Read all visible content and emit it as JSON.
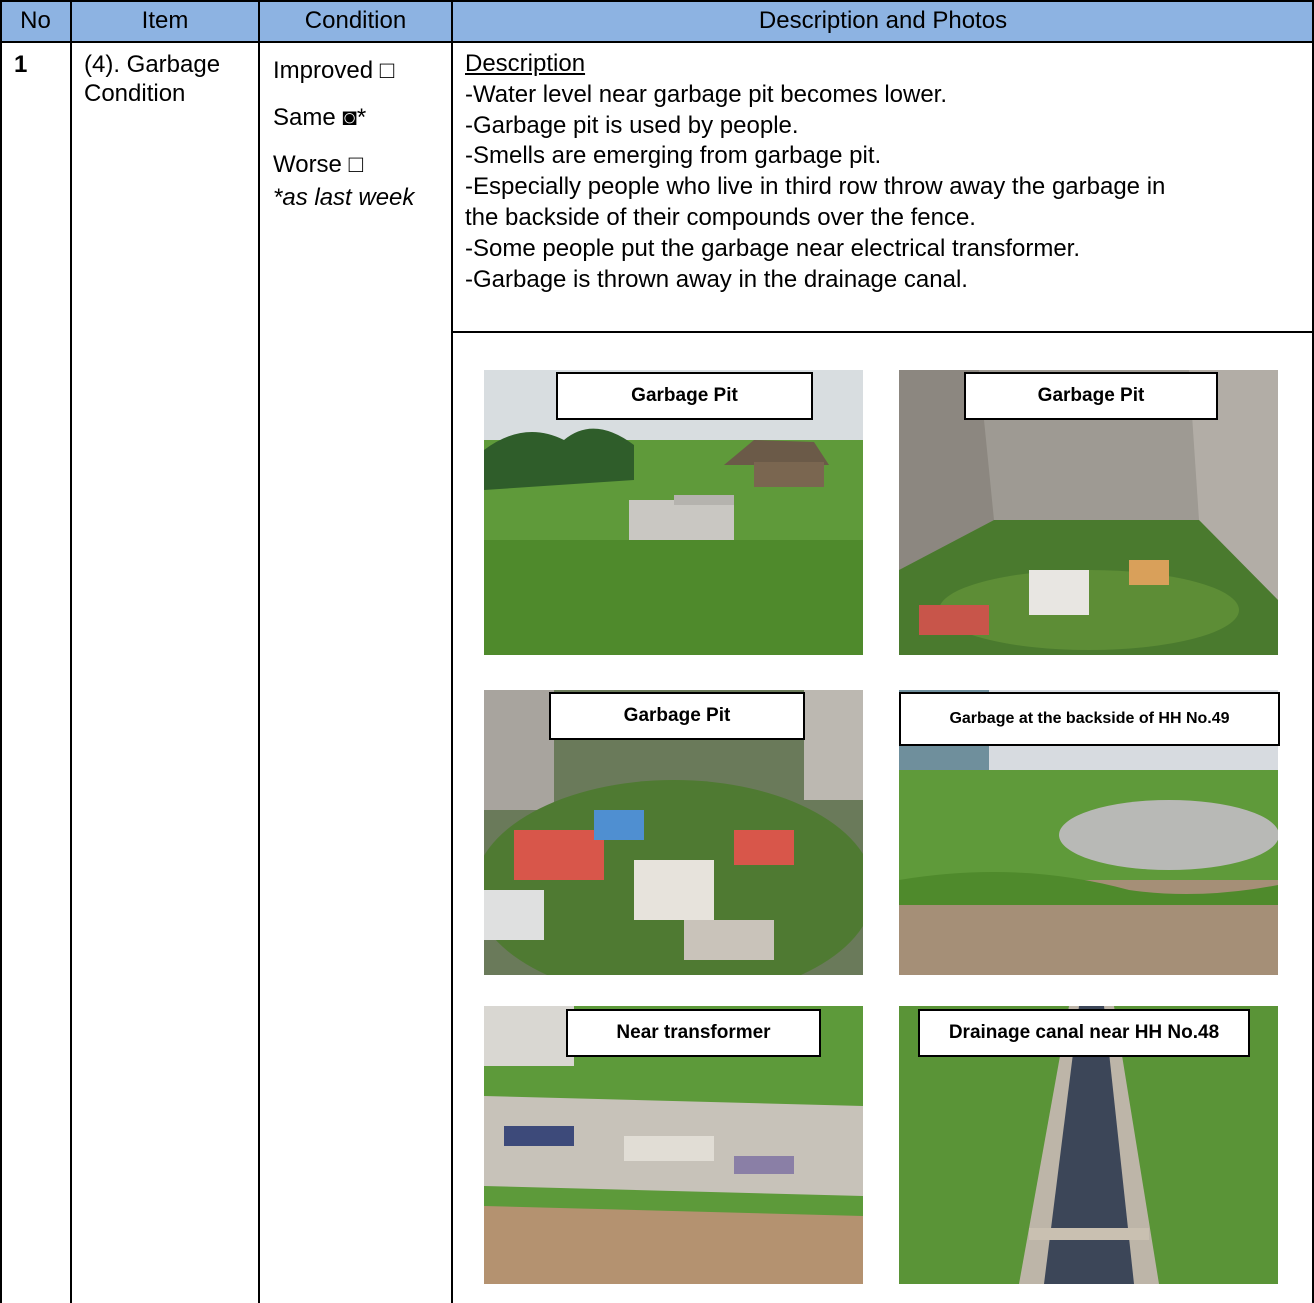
{
  "header": {
    "no": "No",
    "item": "Item",
    "condition": "Condition",
    "description": "Description and Photos"
  },
  "row": {
    "no": "1",
    "item_line1": "(4). Garbage",
    "item_line2": "Condition",
    "condition": {
      "improved": "Improved □",
      "same": "Same ◙*",
      "worse": "Worse □",
      "note": "*as last week"
    },
    "description": {
      "heading": "Description",
      "lines": [
        "-Water level near garbage pit becomes lower.",
        "-Garbage pit is used by people.",
        "-Smells are emerging from garbage pit.",
        "-Especially people who live in third row throw away the garbage in",
        "the backside of their compounds over the fence.",
        "-Some people put the garbage near electrical transformer.",
        "-Garbage is thrown away in the drainage canal."
      ]
    },
    "photos": [
      {
        "caption": "Garbage Pit"
      },
      {
        "caption": "Garbage Pit"
      },
      {
        "caption": "Garbage Pit"
      },
      {
        "caption": "Garbage at the backside of HH No.49"
      },
      {
        "caption": "Near transformer"
      },
      {
        "caption": "Drainage canal near HH No.48"
      }
    ]
  },
  "colors": {
    "header_background": "#8db3e2",
    "grid_lines": "#000000"
  }
}
